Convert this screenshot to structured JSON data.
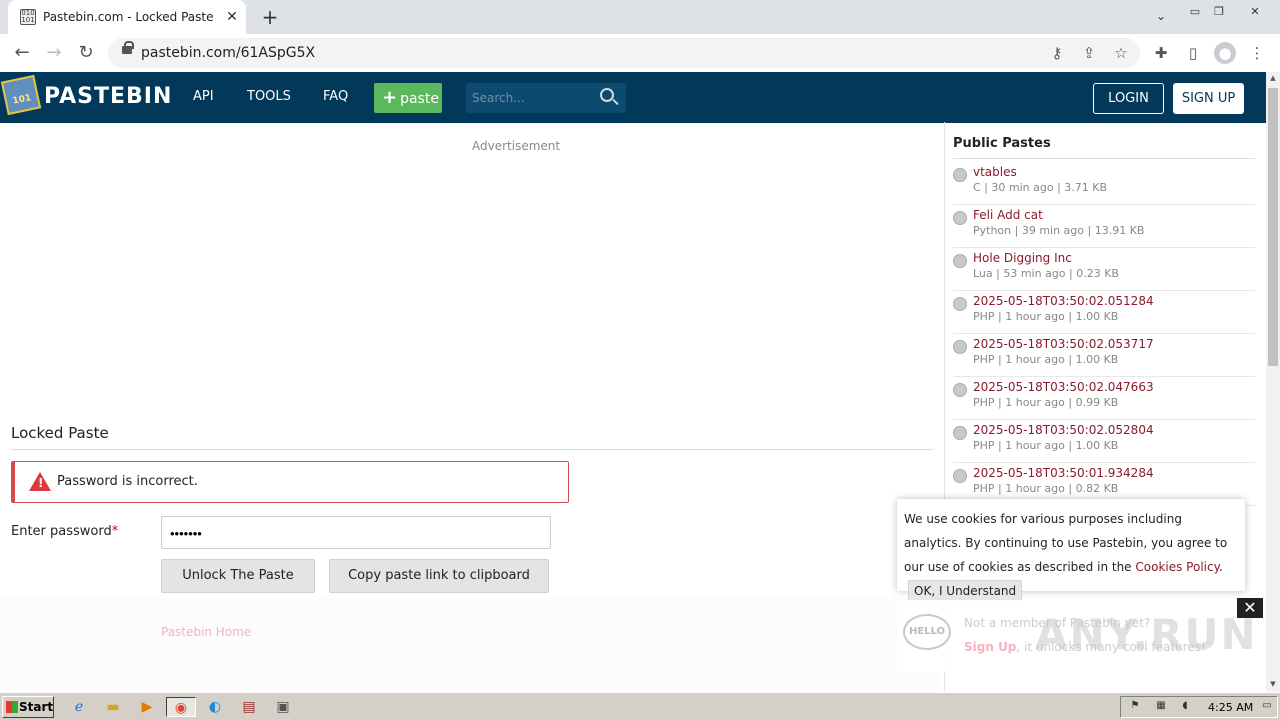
{
  "browser": {
    "tab_title": "Pastebin.com - Locked Paste",
    "url": "pastebin.com/61ASpG5X",
    "favicon_text": "010 101"
  },
  "header": {
    "logo_text": "PASTEBIN",
    "logo_badge": "101",
    "nav": [
      "API",
      "TOOLS",
      "FAQ"
    ],
    "paste_button": "paste",
    "search_placeholder": "Search...",
    "login": "LOGIN",
    "signup": "SIGN UP"
  },
  "main": {
    "advertisement": "Advertisement",
    "heading": "Locked Paste",
    "error": "Password is incorrect.",
    "password_label": "Enter password",
    "password_required": "*",
    "password_value": "•••••••",
    "unlock_button": "Unlock The Paste",
    "copy_button": "Copy paste link to clipboard",
    "home_link": "Pastebin Home"
  },
  "sidebar": {
    "title": "Public Pastes",
    "items": [
      {
        "name": "vtables",
        "meta": "C | 30 min ago | 3.71 KB"
      },
      {
        "name": "Feli Add cat",
        "meta": "Python | 39 min ago | 13.91 KB"
      },
      {
        "name": "Hole Digging Inc",
        "meta": "Lua | 53 min ago | 0.23 KB"
      },
      {
        "name": "2025-05-18T03:50:02.051284",
        "meta": "PHP | 1 hour ago | 1.00 KB"
      },
      {
        "name": "2025-05-18T03:50:02.053717",
        "meta": "PHP | 1 hour ago | 1.00 KB"
      },
      {
        "name": "2025-05-18T03:50:02.047663",
        "meta": "PHP | 1 hour ago | 0.99 KB"
      },
      {
        "name": "2025-05-18T03:50:02.052804",
        "meta": "PHP | 1 hour ago | 1.00 KB"
      },
      {
        "name": "2025-05-18T03:50:01.934284",
        "meta": "PHP | 1 hour ago | 0.82 KB"
      }
    ]
  },
  "cookie": {
    "text_before": "We use cookies for various purposes including analytics. By continuing to use Pastebin, you agree to our use of cookies as described in the ",
    "link": "Cookies Policy",
    "text_after": ".",
    "ok_button": "OK, I Understand"
  },
  "member_banner": {
    "line1": "Not a member of Pastebin yet?",
    "signup_link": "Sign Up",
    "line2_rest": ", it unlocks many cool features!",
    "hello": "HELLO",
    "close": "✕"
  },
  "watermark": "ANY.RUN",
  "taskbar": {
    "start": "Start",
    "clock": "4:25 AM"
  },
  "colors": {
    "header_bg": "#02395a",
    "paste_green": "#5cb85c",
    "error_red": "#d84a4a",
    "link_maroon": "#8a1b2d"
  }
}
